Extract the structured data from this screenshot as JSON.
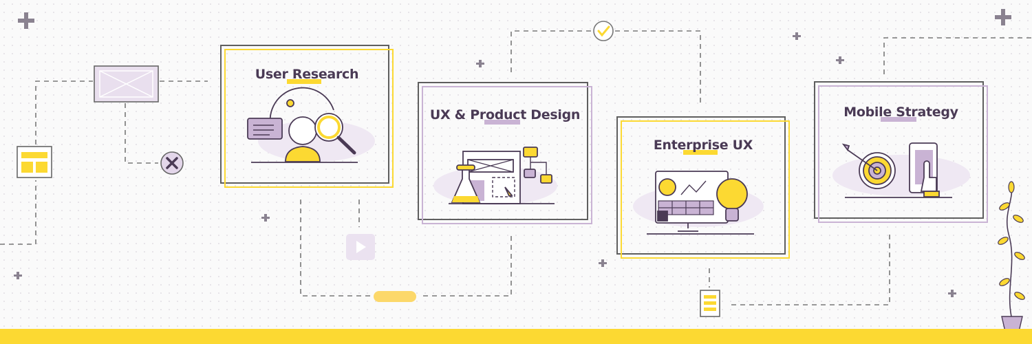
{
  "colors": {
    "dark": "#4a3a55",
    "yellow": "#fcd932",
    "purple": "#c9b3d4",
    "gray": "#5e5e5e",
    "background": "#fafafa"
  },
  "cards": [
    {
      "title": "User Research",
      "accent": "yellow",
      "icon": "research-magnifier-person-icon"
    },
    {
      "title": "UX & Product Design",
      "accent": "purple",
      "icon": "wireframe-flask-flowchart-icon"
    },
    {
      "title": "Enterprise UX",
      "accent": "yellow",
      "icon": "monitor-dashboard-lightbulb-icon"
    },
    {
      "title": "Mobile Strategy",
      "accent": "purple",
      "icon": "target-smartphone-icon"
    }
  ],
  "decor_icons": [
    "wireframe-image-icon",
    "layout-grid-icon",
    "close-circle-icon",
    "play-icon",
    "pill-shape",
    "check-circle-icon",
    "document-icon",
    "plant-pot-icon",
    "plus-icon"
  ]
}
